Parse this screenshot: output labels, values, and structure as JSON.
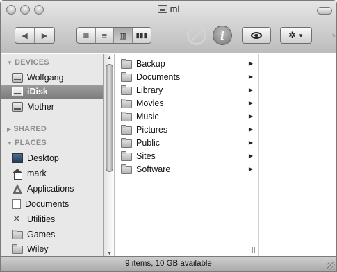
{
  "window": {
    "title": "ml"
  },
  "toolbar": {
    "back_icon": "back-arrow-icon",
    "forward_icon": "forward-arrow-icon",
    "view_modes": [
      "icon-view-icon",
      "list-view-icon",
      "column-view-icon",
      "coverflow-view-icon"
    ],
    "active_view": "column-view-icon",
    "info_label": "i"
  },
  "sidebar": {
    "sections": [
      {
        "label": "DEVICES",
        "expanded": true
      },
      {
        "label": "SHARED",
        "expanded": false
      },
      {
        "label": "PLACES",
        "expanded": true
      }
    ],
    "devices": [
      {
        "label": "Wolfgang",
        "icon": "drive-icon",
        "selected": false
      },
      {
        "label": "iDisk",
        "icon": "idisk-icon",
        "selected": true
      },
      {
        "label": "Mother",
        "icon": "drive-icon",
        "selected": false
      }
    ],
    "places": [
      {
        "label": "Desktop",
        "icon": "desktop-icon"
      },
      {
        "label": "mark",
        "icon": "home-icon"
      },
      {
        "label": "Applications",
        "icon": "applications-icon"
      },
      {
        "label": "Documents",
        "icon": "document-icon"
      },
      {
        "label": "Utilities",
        "icon": "utilities-icon"
      },
      {
        "label": "Games",
        "icon": "folder-icon"
      },
      {
        "label": "Wiley",
        "icon": "folder-icon"
      }
    ]
  },
  "column1": {
    "items": [
      {
        "label": "Backup",
        "has_children": true
      },
      {
        "label": "Documents",
        "has_children": true
      },
      {
        "label": "Library",
        "has_children": true
      },
      {
        "label": "Movies",
        "has_children": true
      },
      {
        "label": "Music",
        "has_children": true
      },
      {
        "label": "Pictures",
        "has_children": true
      },
      {
        "label": "Public",
        "has_children": true
      },
      {
        "label": "Sites",
        "has_children": true
      },
      {
        "label": "Software",
        "has_children": true
      }
    ]
  },
  "statusbar": {
    "text": "9 items, 10 GB available"
  },
  "colors": {
    "titlebar_top": "#e6e6e6",
    "titlebar_bottom": "#bcbcbc",
    "sidebar_bg": "#e8e8e8",
    "selection": "#8c8c8c"
  }
}
